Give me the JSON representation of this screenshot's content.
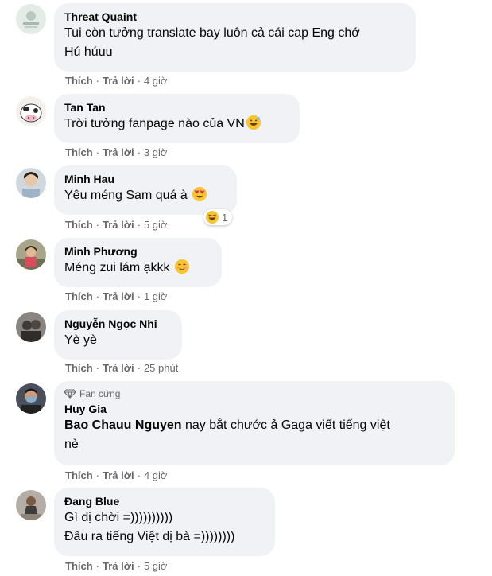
{
  "actions": {
    "like": "Thích",
    "reply": "Trả lời",
    "sep": "·"
  },
  "comments": [
    {
      "name": "Threat Quaint",
      "text": "Tui còn tưởng translate bay luôn cả cái cap Eng chớ\nHú húuu",
      "time": "4 giờ"
    },
    {
      "name": "Tan Tan",
      "text": "Trời tưởng fanpage nào của VN",
      "emoji": "grinning-sweat-emoji",
      "time": "3 giờ"
    },
    {
      "name": "Minh Hau",
      "text": "Yêu méng Sam quá à",
      "emoji": "heart-eyes-emoji",
      "time": "5 giờ",
      "reaction": {
        "icon": "haha-reaction-icon",
        "count": "1"
      }
    },
    {
      "name": "Minh Phương",
      "text": "Méng zui lám ạkkk",
      "emoji": "smiling-blush-emoji",
      "time": "1 giờ"
    },
    {
      "name": "Nguyễn Ngọc Nhi",
      "text": "Yè yè",
      "time": "25 phút"
    },
    {
      "name": "Huy Gia",
      "badge": "Fan cứng",
      "tag": "Bao Chauu Nguyen",
      "text": " nay bắt chước ả Gaga viết tiếng việt\nnè",
      "time": "4 giờ"
    },
    {
      "name": "Đang Blue",
      "text": "Gì dị chời =))))))))))\nĐâu ra tiếng Việt dị bà =))))))))",
      "time": "5 giờ"
    }
  ],
  "colors": {
    "bubble": "#f0f2f5",
    "meta": "#65676b",
    "text": "#050505"
  }
}
